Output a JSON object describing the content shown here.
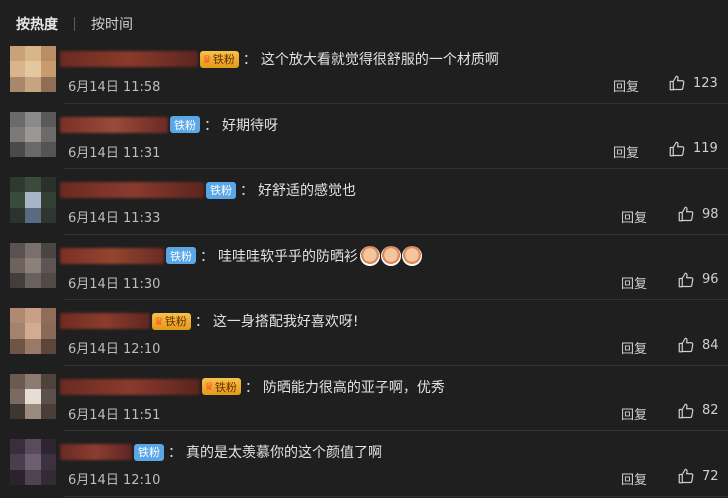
{
  "tabs": [
    {
      "label": "按热度",
      "active": true
    },
    {
      "label": "按时间",
      "active": false
    }
  ],
  "icons": {
    "like": "thumbs-up-icon",
    "fan_badge": "crown-icon",
    "sticker": "face-sticker"
  },
  "reply_label": "回复",
  "comments": [
    {
      "badge_label": "铁粉",
      "badge_style": "gold",
      "text": "这个放大看就觉得很舒服的一个材质啊",
      "time": "6月14日 11:58",
      "likes": "123",
      "avatar_colors": [
        "#c9a27a",
        "#d9b68a",
        "#b98e62",
        "#d8b58c",
        "#e5c79f",
        "#c79b6b",
        "#a9876a",
        "#c6a47f",
        "#8e6f55"
      ],
      "name_colors": [
        "#6b2a22",
        "#8a3a2a",
        "#5c2520"
      ]
    },
    {
      "badge_label": "铁粉",
      "badge_style": "blue",
      "text": "好期待呀",
      "time": "6月14日 11:31",
      "likes": "119",
      "avatar_colors": [
        "#6b6a6a",
        "#8a8a88",
        "#5a5858",
        "#7c7a78",
        "#9a9896",
        "#6d6b6a",
        "#4b4a4a",
        "#6a6868",
        "#555454"
      ],
      "name_colors": [
        "#7a2f27",
        "#9a4a3a",
        "#6a2a24"
      ]
    },
    {
      "badge_label": "铁粉",
      "badge_style": "blue",
      "text": "好舒适的感觉也",
      "time": "6月14日 11:33",
      "likes": "98",
      "avatar_colors": [
        "#2e3a2f",
        "#3c4a3b",
        "#2a302b",
        "#394b3a",
        "#a8b4c8",
        "#334036",
        "#2b332c",
        "#5a6a80",
        "#2f3530"
      ],
      "name_colors": [
        "#6a2a22",
        "#8b3a2d",
        "#5c2620"
      ]
    },
    {
      "badge_label": "铁粉",
      "badge_style": "blue",
      "text": "哇哇哇软乎乎的防晒衫",
      "time": "6月14日 11:30",
      "likes": "96",
      "avatar_colors": [
        "#5a5250",
        "#7a6f6b",
        "#4a4442",
        "#6d625e",
        "#8c807a",
        "#5e5552",
        "#433d3b",
        "#6a605c",
        "#514a47"
      ],
      "name_colors": [
        "#7a2e26",
        "#95452f",
        "#6a2b24"
      ]
    },
    {
      "badge_label": "铁粉",
      "badge_style": "gold",
      "text": "这一身搭配我好喜欢呀!",
      "time": "6月14日 12:10",
      "likes": "84",
      "avatar_colors": [
        "#b08a70",
        "#c9a086",
        "#8f6d58",
        "#a4826e",
        "#d2ac92",
        "#8a6a56",
        "#6e5546",
        "#9a7a66",
        "#5c4639"
      ],
      "name_colors": [
        "#6e2a22",
        "#8c3c2c",
        "#5e2620"
      ]
    },
    {
      "badge_label": "铁粉",
      "badge_style": "gold",
      "text": "防晒能力很高的亚子啊，优秀",
      "time": "6月14日 11:51",
      "likes": "82",
      "avatar_colors": [
        "#6a5a52",
        "#8c7a70",
        "#4e423d",
        "#7a6a62",
        "#e6ddd6",
        "#5d4f49",
        "#3f3531",
        "#9a8a80",
        "#4a3e39"
      ],
      "name_colors": [
        "#6a2a22",
        "#8a3a2c",
        "#5a2420"
      ]
    },
    {
      "badge_label": "铁粉",
      "badge_style": "blue",
      "text": "真的是太羡慕你的这个颜值了啊",
      "time": "6月14日 12:10",
      "likes": "72",
      "avatar_colors": [
        "#3a2e3c",
        "#5a4a5e",
        "#2e2530",
        "#4a3d4e",
        "#6e5e72",
        "#3c3140",
        "#2a222c",
        "#4f4252",
        "#342a36"
      ],
      "name_colors": [
        "#6a2a24",
        "#8c3d30",
        "#5c2622"
      ]
    }
  ]
}
